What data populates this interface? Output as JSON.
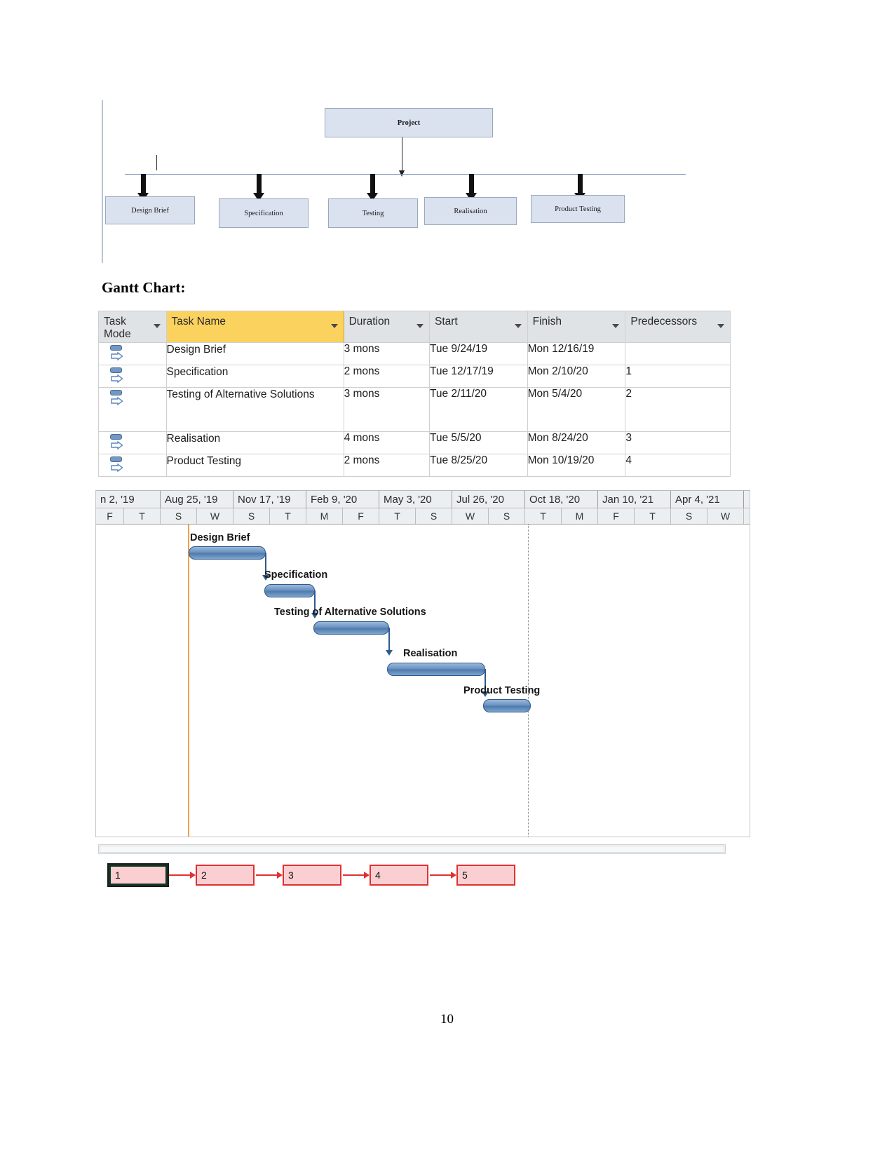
{
  "org_diagram": {
    "root": {
      "label": "Project"
    },
    "children": [
      {
        "label": "Design Brief"
      },
      {
        "label": "Specification"
      },
      {
        "label": "Testing"
      },
      {
        "label": "Realisation"
      },
      {
        "label": "Product Testing"
      }
    ]
  },
  "heading": {
    "text": "Gantt Chart:"
  },
  "table": {
    "columns": [
      {
        "label": "Task Mode",
        "sort_icon": "chevron-down-icon"
      },
      {
        "label": "Task Name",
        "sort_icon": "chevron-down-icon",
        "highlight_color": "#fbd25e"
      },
      {
        "label": "Duration",
        "sort_icon": "chevron-down-icon"
      },
      {
        "label": "Start",
        "sort_icon": "chevron-down-icon"
      },
      {
        "label": "Finish",
        "sort_icon": "chevron-down-icon"
      },
      {
        "label": "Predecessors",
        "sort_icon": "chevron-down-icon"
      }
    ],
    "rows": [
      {
        "mode_icon": "auto-scheduled-icon",
        "name": "Design Brief",
        "duration": "3 mons",
        "start": "Tue 9/24/19",
        "finish": "Mon 12/16/19",
        "predecessors": ""
      },
      {
        "mode_icon": "auto-scheduled-icon",
        "name": "Specification",
        "duration": "2 mons",
        "start": "Tue 12/17/19",
        "finish": "Mon 2/10/20",
        "predecessors": "1"
      },
      {
        "mode_icon": "auto-scheduled-icon",
        "name": "Testing of Alternative Solutions",
        "duration": "3 mons",
        "start": "Tue 2/11/20",
        "finish": "Mon 5/4/20",
        "predecessors": "2"
      },
      {
        "mode_icon": "auto-scheduled-icon",
        "name": "Realisation",
        "duration": "4 mons",
        "start": "Tue 5/5/20",
        "finish": "Mon 8/24/20",
        "predecessors": "3"
      },
      {
        "mode_icon": "auto-scheduled-icon",
        "name": "Product Testing",
        "duration": "2 mons",
        "start": "Tue 8/25/20",
        "finish": "Mon 10/19/20",
        "predecessors": "4"
      }
    ]
  },
  "timeline": {
    "month_bands": [
      "n 2, '19",
      "Aug 25, '19",
      "Nov 17, '19",
      "Feb 9, '20",
      "May 3, '20",
      "Jul 26, '20",
      "Oct 18, '20",
      "Jan 10, '21",
      "Apr 4, '21"
    ],
    "day_labels": [
      "F",
      "T",
      "S",
      "W",
      "S",
      "T",
      "M",
      "F",
      "T",
      "S",
      "W",
      "S",
      "T",
      "M",
      "F",
      "T",
      "S",
      "W"
    ],
    "today_marker_color": "#f0a04b",
    "status_line_style": "dotted"
  },
  "chart_data": {
    "type": "bar",
    "title": "Gantt Chart:",
    "xlabel": "",
    "ylabel": "",
    "categories": [
      "Design Brief",
      "Specification",
      "Testing of Alternative Solutions",
      "Realisation",
      "Product Testing"
    ],
    "values": [
      3,
      2,
      3,
      4,
      2
    ],
    "series": [
      {
        "name": "Duration (months)",
        "values": [
          3,
          2,
          3,
          4,
          2
        ]
      }
    ],
    "tasks": [
      {
        "name": "Design Brief",
        "duration_months": 3,
        "start": "Tue 9/24/19",
        "finish": "Mon 12/16/19",
        "predecessors": ""
      },
      {
        "name": "Specification",
        "duration_months": 2,
        "start": "Tue 12/17/19",
        "finish": "Mon 2/10/20",
        "predecessors": "1"
      },
      {
        "name": "Testing of Alternative Solutions",
        "duration_months": 3,
        "start": "Tue 2/11/20",
        "finish": "Mon 5/4/20",
        "predecessors": "2"
      },
      {
        "name": "Realisation",
        "duration_months": 4,
        "start": "Tue 5/5/20",
        "finish": "Mon 8/24/20",
        "predecessors": "3"
      },
      {
        "name": "Product Testing",
        "duration_months": 2,
        "start": "Tue 8/25/20",
        "finish": "Mon 10/19/20",
        "predecessors": "4"
      }
    ],
    "axis_ticks": [
      "n 2, '19",
      "Aug 25, '19",
      "Nov 17, '19",
      "Feb 9, '20",
      "May 3, '20",
      "Jul 26, '20",
      "Oct 18, '20",
      "Jan 10, '21",
      "Apr 4, '21"
    ],
    "grid": true,
    "legend": "none",
    "bar_color": "#4e7cae",
    "link_color": "#2f5a8c"
  },
  "network": {
    "nodes": [
      {
        "id": "1",
        "label": "1",
        "selected": true
      },
      {
        "id": "2",
        "label": "2",
        "selected": false
      },
      {
        "id": "3",
        "label": "3",
        "selected": false
      },
      {
        "id": "4",
        "label": "4",
        "selected": false
      },
      {
        "id": "5",
        "label": "5",
        "selected": false
      }
    ],
    "link_color": "#e03131",
    "node_fill": "#fbcfd2"
  },
  "page": {
    "number": "10"
  }
}
